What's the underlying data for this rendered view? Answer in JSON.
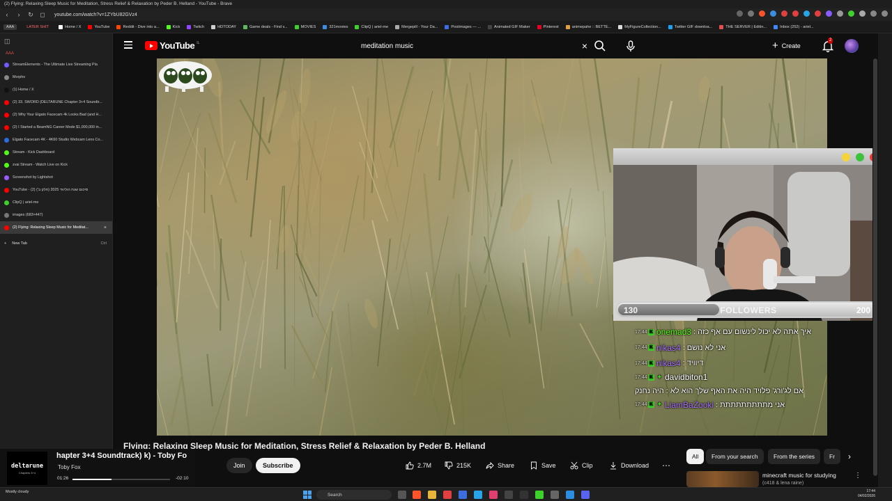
{
  "browser": {
    "window_title": "(2) Flying: Relaxing Sleep Music for Meditation, Stress Relief & Relaxation by Peder B. Helland - YouTube - Brave",
    "url": "youtube.com/watch?v=1ZYbU82GVz4",
    "bookmarks": [
      "AAA",
      "LATER SHIT",
      "Home / X",
      "YouTube",
      "Reddit - Dive into a...",
      "Kick",
      "Twitch",
      "HDTODAY",
      "Game deals - Find v...",
      "MOVIES",
      "321movies",
      "ClipQ | ariel-me",
      "Mergepill - Your Da...",
      "Postimages — ...",
      "Animated GIF Maker",
      "Pinterest",
      "animepahe :: BETTE...",
      "MyFigureCollection...",
      "Twitter GIF downloa...",
      "THE SERVER | Editin...",
      "Inbox (252) - ariel..."
    ]
  },
  "sidebar": {
    "group_label": "AAA",
    "tabs": [
      {
        "label": "StreamElements - The Ultimate Live Streaming Pla",
        "color": "#6f5bff"
      },
      {
        "label": "Morpho",
        "color": "#888888"
      },
      {
        "label": "(1) Home / X",
        "color": "#111111"
      },
      {
        "label": "(2) 33. SWORD (DELTARUNE Chapter 3+4 Soundtr...",
        "color": "#ff0000"
      },
      {
        "label": "(2) Why Your Elgato Facecam 4k Looks Bad (and H...",
        "color": "#ff0000"
      },
      {
        "label": "(2) I Started a BeamNG Career Mode $1,000,000 in...",
        "color": "#ff0000"
      },
      {
        "label": "Elgato Facecam 4K - 4K60 Studio Webcam Lens Co...",
        "color": "#2d6cdf"
      },
      {
        "label": "Stream - Kick Dashboard",
        "color": "#53fc18"
      },
      {
        "label": "zvai Stream - Watch Live on Kick",
        "color": "#53fc18"
      },
      {
        "label": "Screenshot by Lightshot",
        "color": "#9a5cff"
      },
      {
        "label": "YouTube - (2) סיכום שנת הוליווד 2025 (חלק ב')",
        "color": "#ff0000"
      },
      {
        "label": "ClipQ | ariel-me",
        "color": "#3fd12b"
      },
      {
        "label": "images (683×447)",
        "color": "#777777"
      },
      {
        "label": "(2) Flying: Relaxing Sleep Music for Meditat...",
        "color": "#ff0000"
      }
    ],
    "new_tab_label": "New Tab",
    "new_tab_shortcut": "Ctrl"
  },
  "youtube": {
    "logo_text": "YouTube",
    "logo_region": "IL",
    "search_query": "meditation music",
    "create_label": "Create",
    "notification_count": "2",
    "video_title": "Flying: Relaxing Sleep Music for Meditation, Stress Relief & Relaxation by Peder B. Helland",
    "join_label": "Join",
    "subscribe_label": "Subscribe",
    "likes": "2.7M",
    "dislikes": "215K",
    "share_label": "Share",
    "save_label": "Save",
    "clip_label": "Clip",
    "download_label": "Download",
    "chips": [
      "All",
      "From your search",
      "From the series",
      "Fr"
    ],
    "recommendation": {
      "title": "minecraft music for studying",
      "subtitle": "(c418 & lena raine)"
    }
  },
  "overlay": {
    "followers_label": "FOLLOWERS",
    "followers_current": "130",
    "followers_goal": "200",
    "followers_progress": 0.65,
    "chat": [
      {
        "time": "17:44",
        "user": "onemad3",
        "user_color": "#53fc18",
        "text": "איך אתה לא יכול לינשום עם אף כזה :",
        "sub": false
      },
      {
        "time": "17:44",
        "user": "nikas4",
        "user_color": "#a970ff",
        "text": "אני לא נושם :",
        "sub": false
      },
      {
        "time": "17:44",
        "user": "nikas4",
        "user_color": "#a970ff",
        "text": "דיוויד :",
        "sub": false
      },
      {
        "time": "17:44",
        "user": "davidbiton1",
        "user_color": "#ffffff",
        "text": "אם לג'ורג' פלויד היה את האף שלך הוא לא : היה נחנק",
        "sub": true
      },
      {
        "time": "17:44",
        "user": "LiamBaZooki",
        "user_color": "#a970ff",
        "text": "אני מתתתתתתתתת :",
        "sub": true
      }
    ]
  },
  "media_popup": {
    "art_title": "deltarune",
    "art_subtitle": "Chapters 3+4",
    "title": "hapter 3+4 Soundtrack) k) - Toby Fo",
    "artist": "Toby Fox",
    "time_current": "01:26",
    "time_total": "-02:10",
    "progress": 0.4
  },
  "taskbar": {
    "weather": "Mostly cloudy",
    "search_label": "Search",
    "time": "17:44",
    "date": "04/02/2026"
  }
}
